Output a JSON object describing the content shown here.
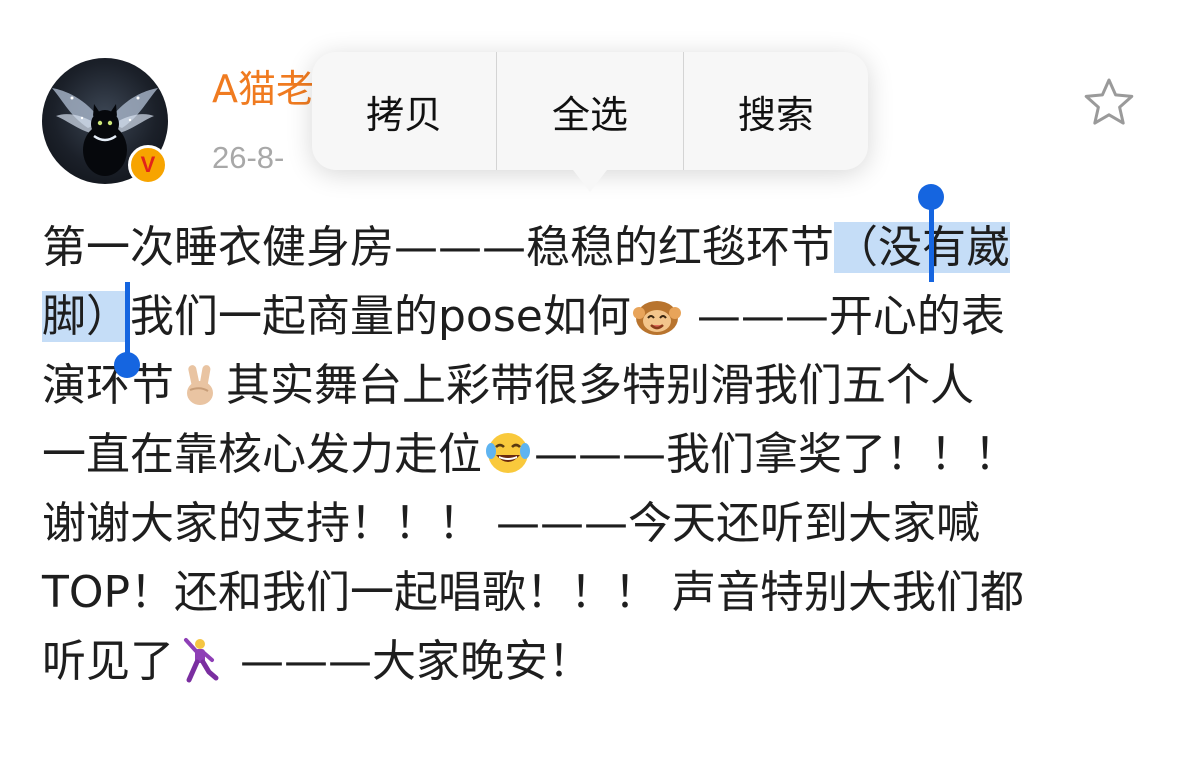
{
  "post": {
    "author_name": "A猫老",
    "meta": "26-8-",
    "lines": [
      {
        "pre": "第一次睡衣健身房———稳稳的红毯环节",
        "sel": "（没有崴"
      },
      {
        "sel": "脚）",
        "post": "我们一起商量的pose如何"
      },
      {
        "post": "———开心的表"
      },
      {
        "pre": "演环节",
        "post": "其实舞台上彩带很多特别滑我们五个人"
      },
      {
        "pre": "一直在靠核心发力走位",
        "post": "———我们拿奖了！！！"
      },
      {
        "text": "谢谢大家的支持！！！ ———今天还听到大家喊"
      },
      {
        "text": " TOP！还和我们一起唱歌！！！ 声音特别大我们都"
      },
      {
        "pre": "听见了",
        "post": " ———大家晚安！"
      }
    ]
  },
  "context_menu": {
    "copy_label": "拷贝",
    "select_all_label": "全选",
    "search_label": "搜索"
  },
  "icons": {
    "badge": "verified-v-icon",
    "star": "star-outline-icon",
    "emoji_1": "monkey-emoji-icon",
    "emoji_2": "victory-hand-emoji-icon",
    "emoji_3": "tears-of-joy-emoji-icon",
    "emoji_4": "dancing-man-emoji-icon"
  },
  "badge_letter": "V",
  "colors": {
    "author_name": "#f07b20",
    "selection": "#c5ddf7",
    "selection_handle": "#1565e0",
    "meta_text": "#a8a8a8"
  }
}
